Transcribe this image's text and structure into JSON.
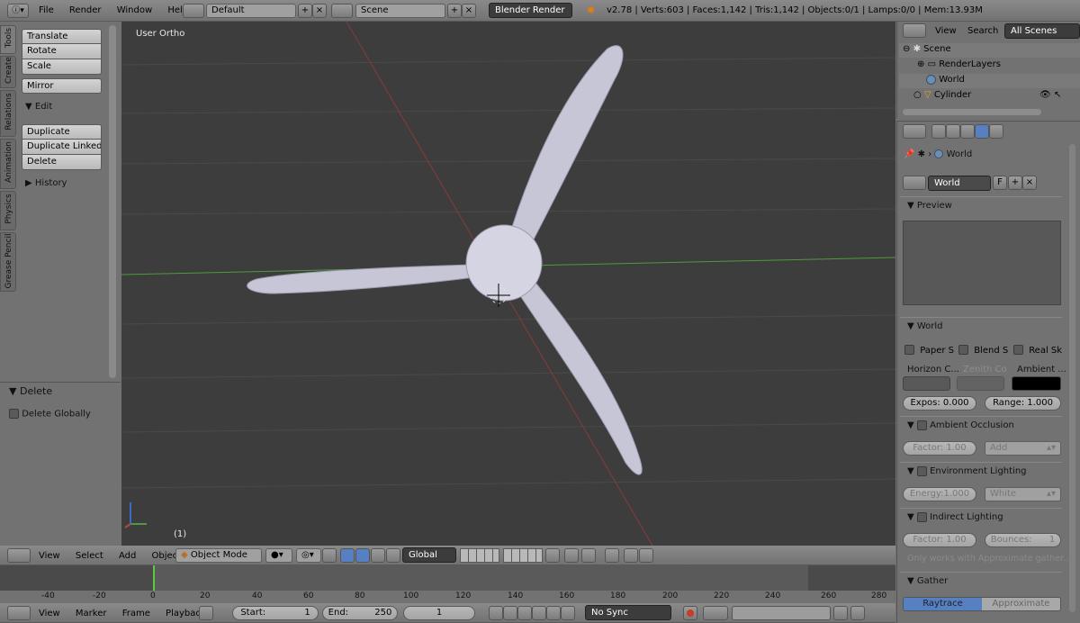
{
  "top_menu": {
    "items": [
      "File",
      "Render",
      "Window",
      "Help"
    ],
    "layout": "Default",
    "scene": "Scene",
    "engine": "Blender Render",
    "stats": "v2.78 | Verts:603 | Faces:1,142 | Tris:1,142 | Objects:0/1 | Lamps:0/0 | Mem:13.93M"
  },
  "tool_tabs": [
    "Tools",
    "Create",
    "Relations",
    "Animation",
    "Physics",
    "Grease Pencil"
  ],
  "tools": {
    "transform": [
      "Translate",
      "Rotate",
      "Scale"
    ],
    "mirror": "Mirror",
    "edit_header": "Edit",
    "edit": [
      "Duplicate",
      "Duplicate Linked",
      "Delete"
    ],
    "history": "History"
  },
  "operator": {
    "title": "Delete",
    "option": "Delete Globally"
  },
  "viewport": {
    "view_name": "User Ortho",
    "frame_label": "(1)"
  },
  "view3d_header": {
    "menus": [
      "View",
      "Select",
      "Add",
      "Object"
    ],
    "mode": "Object Mode",
    "orientation": "Global"
  },
  "timeline": {
    "ticks": [
      "-40",
      "-20",
      "0",
      "20",
      "40",
      "60",
      "80",
      "100",
      "120",
      "140",
      "160",
      "180",
      "200",
      "220",
      "240",
      "260",
      "280"
    ],
    "menus": [
      "View",
      "Marker",
      "Frame",
      "Playback"
    ],
    "start_label": "Start:",
    "start": "1",
    "end_label": "End:",
    "end": "250",
    "current": "1",
    "sync": "No Sync"
  },
  "outliner": {
    "menus": [
      "View",
      "Search"
    ],
    "filter": "All Scenes",
    "items": [
      "Scene",
      "RenderLayers",
      "World",
      "Cylinder"
    ]
  },
  "properties": {
    "context": "World",
    "world_name": "World",
    "world_fake": "F",
    "preview": "Preview",
    "world_panel": "World",
    "checks": [
      "Paper S",
      "Blend S",
      "Real Sk"
    ],
    "colors": [
      "Horizon C...",
      "Zenith Co",
      "Ambient ..."
    ],
    "exposure": "Expos: 0.000",
    "range": "Range: 1.000",
    "ao": {
      "title": "Ambient Occlusion",
      "factor": "Factor:",
      "factor_val": "1.00",
      "blend": "Add"
    },
    "env": {
      "title": "Environment Lighting",
      "energy": "Energy:",
      "energy_val": "1.000",
      "source": "White"
    },
    "indirect": {
      "title": "Indirect Lighting",
      "factor": "Factor:",
      "factor_val": "1.00",
      "bounces": "Bounces:",
      "bounces_val": "1",
      "note": "Only works with Approximate gather..."
    },
    "gather": {
      "title": "Gather",
      "tabs": [
        "Raytrace",
        "Approximate"
      ]
    }
  },
  "colors": {
    "viewport_bg": "#3d3d3d",
    "accent": "#5680c2",
    "x_axis": "#b04a4a",
    "y_axis": "#4f9a3c"
  }
}
